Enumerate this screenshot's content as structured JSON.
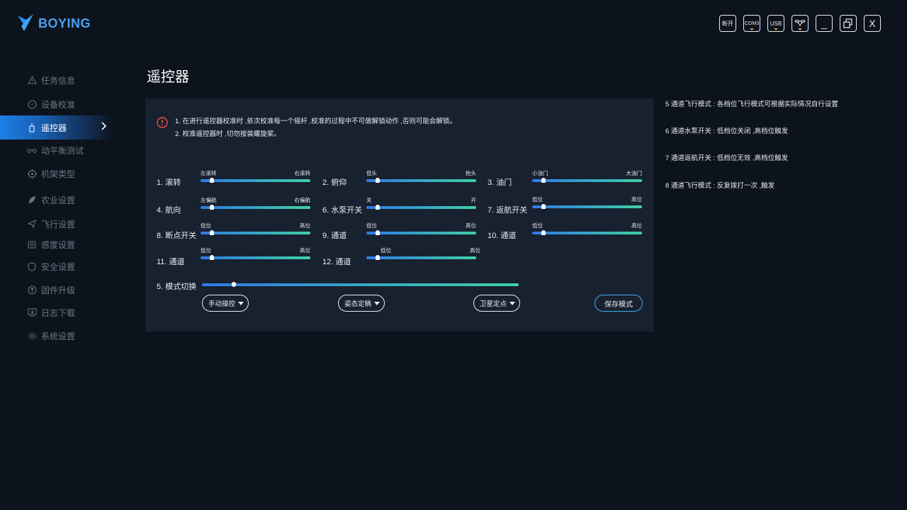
{
  "app": {
    "logo_text": "BOYING"
  },
  "topbar": {
    "disconnect": "断开",
    "com": "COM3",
    "usb": "USB",
    "minimize": "_",
    "close": "X"
  },
  "sidebar": {
    "items": [
      {
        "label": "任务信息",
        "icon": "warning-icon"
      },
      {
        "label": "设备校准",
        "icon": "compass-icon"
      },
      {
        "label": "遥控器",
        "icon": "remote-icon",
        "active": true
      },
      {
        "label": "动平衡测试",
        "icon": "balance-icon"
      },
      {
        "label": "机架类型",
        "icon": "target-icon"
      },
      {
        "label": "农业设置",
        "icon": "leaf-icon"
      },
      {
        "label": "飞行设置",
        "icon": "plane-icon"
      },
      {
        "label": "感度设置",
        "icon": "sensor-icon"
      },
      {
        "label": "安全设置",
        "icon": "shield-icon"
      },
      {
        "label": "固件升级",
        "icon": "upgrade-icon"
      },
      {
        "label": "日志下载",
        "icon": "download-icon"
      },
      {
        "label": "系统设置",
        "icon": "gear-icon"
      }
    ]
  },
  "page": {
    "title": "遥控器"
  },
  "warning": {
    "line1": "1. 在进行遥控器校准时 ,依次校准每一个摇杆 ,校准的过程中不可做解锁动作 ,否则可能会解锁。",
    "line2": "2. 校准遥控器时 ,切勿按装螺旋桨。"
  },
  "channels": [
    {
      "label": "1. 滚转",
      "lo": "左滚转",
      "hi": "右滚转",
      "value": 0.1
    },
    {
      "label": "2. 俯仰",
      "lo": "低头",
      "hi": "抬头",
      "value": 0.1
    },
    {
      "label": "3. 油门",
      "lo": "小油门",
      "hi": "大油门",
      "value": 0.1
    },
    {
      "label": "4. 航向",
      "lo": "左偏航",
      "hi": "右偏航",
      "value": 0.1
    },
    {
      "label": "6. 水泵开关",
      "lo": "关",
      "hi": "开",
      "value": 0.1
    },
    {
      "label": "7. 返航开关",
      "lo": "低位",
      "hi": "高位",
      "value": 0.1
    },
    {
      "label": "8. 断点开关",
      "lo": "低位",
      "hi": "高位",
      "value": 0.1
    },
    {
      "label": "9. 通道",
      "lo": "低位",
      "hi": "高位",
      "value": 0.1
    },
    {
      "label": "10. 通道",
      "lo": "低位",
      "hi": "高位",
      "value": 0.1
    },
    {
      "label": "11. 通道",
      "lo": "低位",
      "hi": "高位",
      "value": 0.1
    },
    {
      "label": "12. 通道",
      "lo": "低位",
      "hi": "高位",
      "value": 0.1
    }
  ],
  "mode": {
    "label": "5. 模式切换",
    "value": 0.1,
    "options": [
      "手动操控",
      "姿态定稿",
      "卫星定点"
    ],
    "save_label": "保存模式"
  },
  "notes": [
    "5 通道飞行模式 : 各档位飞行模式可根据实际情况自行设置",
    "6 通道水泵开关 : 低档位关闭 ,高档位触发",
    "7 通道返航开关 : 低档位无效 ,高档位触发",
    "8 通道飞行模式 : 反复拨打一次 ,触发"
  ],
  "colors": {
    "accent": "#1e7ee8",
    "track_start": "#2f7be8",
    "track_end": "#3fd1a3",
    "warning": "#e8553a"
  }
}
